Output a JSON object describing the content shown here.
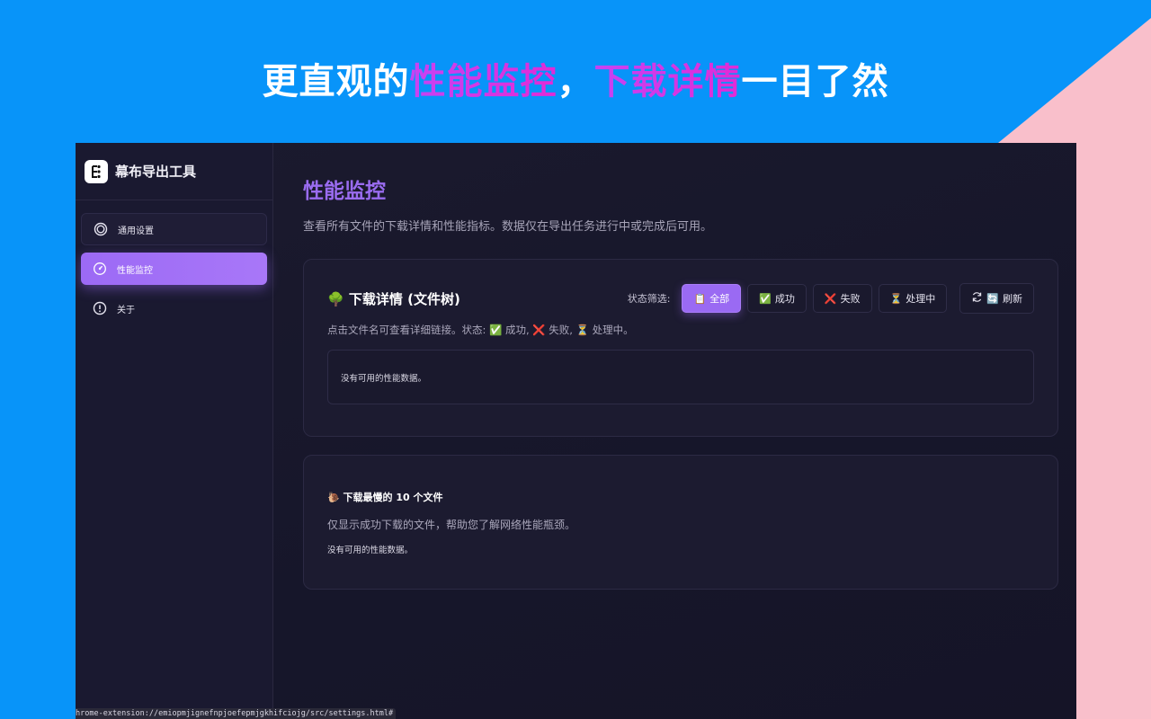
{
  "banner": {
    "part1": "更直观的",
    "highlight1": "性能监控",
    "sep": "，",
    "highlight2": "下载详情",
    "part2": "一目了然"
  },
  "app": {
    "name": "幕布导出工具"
  },
  "sidebar": {
    "items": [
      {
        "label": "通用设置",
        "icon": "settings-ring-icon"
      },
      {
        "label": "性能监控",
        "icon": "speedometer-icon"
      },
      {
        "label": "关于",
        "icon": "info-icon"
      }
    ]
  },
  "main": {
    "title": "性能监控",
    "description": "查看所有文件的下载详情和性能指标。数据仅在导出任务进行中或完成后可用。"
  },
  "download_card": {
    "title_emoji": "🌳",
    "title": "下载详情 (文件树)",
    "filter_label": "状态筛选:",
    "filters": [
      {
        "emoji": "📋",
        "label": "全部"
      },
      {
        "emoji": "✅",
        "label": "成功"
      },
      {
        "emoji": "❌",
        "label": "失败"
      },
      {
        "emoji": "⏳",
        "label": "处理中"
      }
    ],
    "refresh": {
      "emoji": "🔄",
      "label": "刷新"
    },
    "hint": "点击文件名可查看详细链接。状态: ✅ 成功, ❌ 失败, ⏳ 处理中。",
    "empty": "没有可用的性能数据。"
  },
  "slowest_card": {
    "title_emoji": "🐌",
    "title": "下载最慢的 10 个文件",
    "description": "仅显示成功下载的文件，帮助您了解网络性能瓶颈。",
    "empty": "没有可用的性能数据。"
  },
  "status_bar": {
    "url": "hrome-extension://emiopmjignefnpjoefepmjgkhifciojg/src/settings.html#"
  },
  "colors": {
    "background_blue": "#0894f9",
    "corner_pink": "#f9bfcb",
    "accent_purple": "#9a6af3"
  }
}
